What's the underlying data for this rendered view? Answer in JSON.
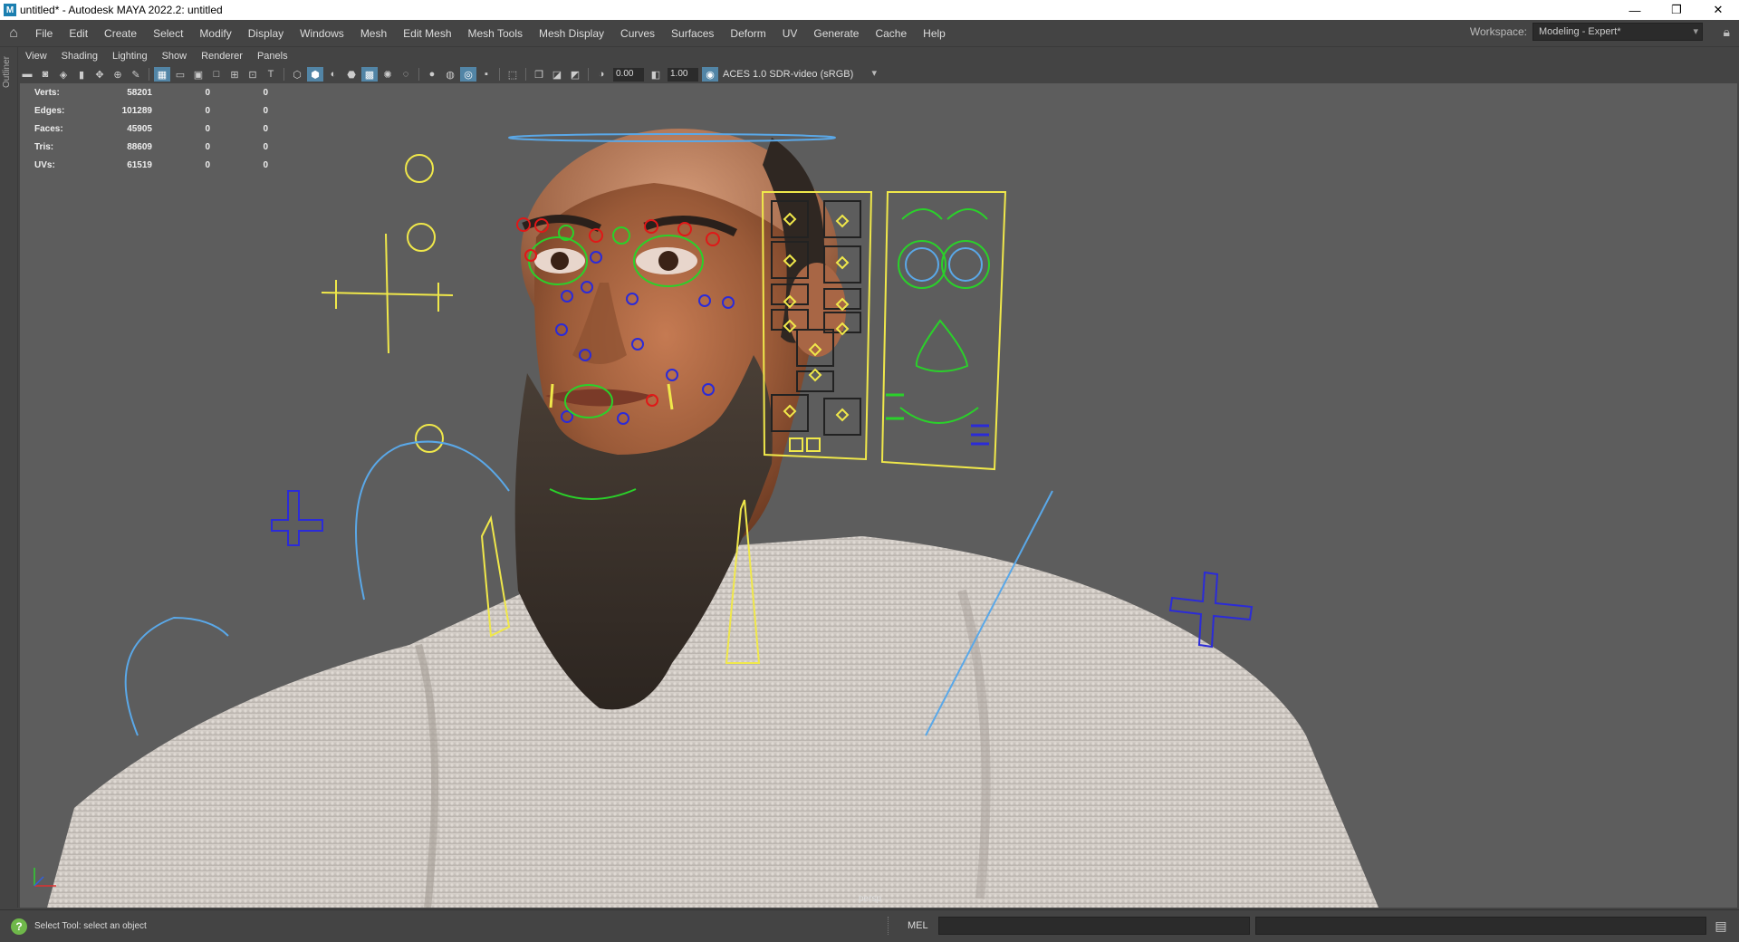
{
  "window": {
    "title": "untitled* - Autodesk MAYA 2022.2: untitled",
    "icon_letter": "M",
    "buttons": [
      "—",
      "❐",
      "✕"
    ]
  },
  "menubar": {
    "items": [
      "File",
      "Edit",
      "Create",
      "Select",
      "Modify",
      "Display",
      "Windows",
      "Mesh",
      "Edit Mesh",
      "Mesh Tools",
      "Mesh Display",
      "Curves",
      "Surfaces",
      "Deform",
      "UV",
      "Generate",
      "Cache",
      "Help"
    ],
    "workspace_label": "Workspace:",
    "workspace_value": "Modeling - Expert*"
  },
  "outliner_label": "Outliner",
  "panel": {
    "menus": [
      "View",
      "Shading",
      "Lighting",
      "Show",
      "Renderer",
      "Panels"
    ],
    "exposure": "0.00",
    "gamma": "1.00",
    "color_space": "ACES 1.0 SDR-video (sRGB)"
  },
  "hud": {
    "rows": [
      {
        "label": "Verts:",
        "value": "58201",
        "c1": "0",
        "c2": "0"
      },
      {
        "label": "Edges:",
        "value": "101289",
        "c1": "0",
        "c2": "0"
      },
      {
        "label": "Faces:",
        "value": "45905",
        "c1": "0",
        "c2": "0"
      },
      {
        "label": "Tris:",
        "value": "88609",
        "c1": "0",
        "c2": "0"
      },
      {
        "label": "UVs:",
        "value": "61519",
        "c1": "0",
        "c2": "0"
      }
    ]
  },
  "camera_label": "persp",
  "status": {
    "help_text": "Select Tool: select an object",
    "mel_label": "MEL"
  },
  "colors": {
    "viewport_bg": "#5d5d5d",
    "rig_yellow": "#f0e84a",
    "rig_green": "#2ad12a",
    "rig_red": "#e01818",
    "rig_blue": "#2b2bd8",
    "rig_cyan": "#5aa8e8"
  }
}
